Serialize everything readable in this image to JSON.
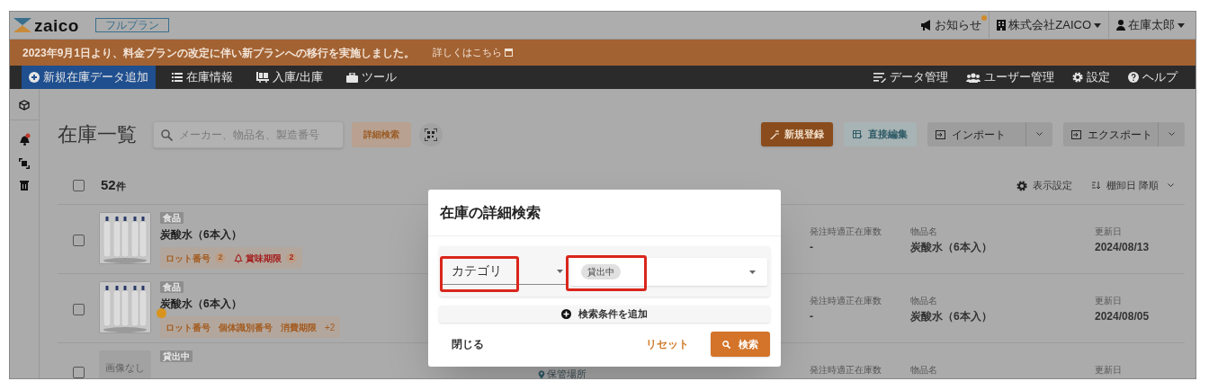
{
  "header": {
    "logo": "zaico",
    "plan_badge": "フルプラン",
    "notices": {
      "label": "お知らせ",
      "unread": true
    },
    "company": "株式会社ZAICO",
    "user": "在庫太郎"
  },
  "banner": {
    "message": "2023年9月1日より、料金プランの改定に伴い新プランへの移行を実施しました。",
    "link": "詳しくはこちら"
  },
  "nav": {
    "left": [
      {
        "label": "新規在庫データ追加",
        "kind": "add",
        "selected": true
      },
      {
        "label": "在庫情報",
        "kind": "list",
        "selected": false
      },
      {
        "label": "入庫/出庫",
        "kind": "cart",
        "selected": false
      },
      {
        "label": "ツール",
        "kind": "tools",
        "selected": false
      }
    ],
    "right": [
      {
        "label": "データ管理",
        "kind": "data"
      },
      {
        "label": "ユーザー管理",
        "kind": "users"
      },
      {
        "label": "設定",
        "kind": "settings"
      },
      {
        "label": "ヘルプ",
        "kind": "help"
      }
    ]
  },
  "page": {
    "title": "在庫一覧",
    "search_placeholder": "メーカー、物品名、製造番号",
    "advanced_search": "詳細検索",
    "buttons": [
      {
        "label": "新規登録",
        "kind": "primary"
      },
      {
        "label": "直接編集",
        "kind": "secondary"
      },
      {
        "label": "インポート",
        "kind": "import"
      },
      {
        "label": "エクスポート",
        "kind": "export"
      }
    ]
  },
  "list": {
    "checked": false,
    "count": "52",
    "count_unit": "件",
    "display_settings": "表示設定",
    "sort": "棚卸日 降順",
    "rows": [
      {
        "checked": false,
        "category": "食品",
        "name": "炭酸水（6本入）",
        "warning": false,
        "tags": [
          {
            "label": "ロット番号",
            "count": "2",
            "kind": "lot"
          },
          {
            "label": "賞味期限",
            "count": "2",
            "kind": "alert"
          }
        ],
        "stock_label": "発注時適正在庫数",
        "stock": "-",
        "item_label": "物品名",
        "item": "炭酸水（6本入）",
        "updated_label": "更新日",
        "updated": "2024/08/13"
      },
      {
        "checked": false,
        "category": "食品",
        "name": "炭酸水（6本入）",
        "warning": true,
        "tags": [
          {
            "label": "ロット番号",
            "kind": "lot"
          },
          {
            "label": "個体識別番号",
            "kind": "lot"
          },
          {
            "label": "消費期限",
            "kind": "lot"
          },
          {
            "label": "+2",
            "kind": "more"
          }
        ],
        "stock_label": "発注時適正在庫数",
        "stock": "-",
        "item_label": "物品名",
        "item": "炭酸水（6本入）",
        "updated_label": "更新日",
        "updated": "2024/08/05"
      },
      {
        "checked": false,
        "no_image": "画像なし",
        "category": "貸出中",
        "location": "保管場所",
        "stock_label": "発注時適正在庫数",
        "item_label": "物品名",
        "updated_label": "更新日"
      }
    ]
  },
  "modal": {
    "title": "在庫の詳細検索",
    "field": "カテゴリ",
    "chips": [
      "貸出中"
    ],
    "add_condition": "検索条件を追加",
    "close": "閉じる",
    "reset": "リセット",
    "search": "検索"
  }
}
